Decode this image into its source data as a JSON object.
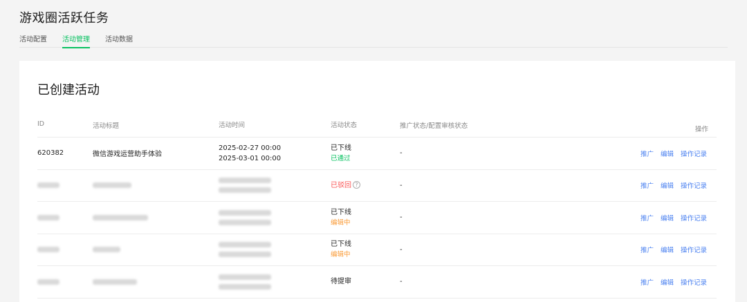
{
  "header": {
    "title": "游戏圈活跃任务"
  },
  "tabs": [
    {
      "label": "活动配置"
    },
    {
      "label": "活动管理"
    },
    {
      "label": "活动数据"
    }
  ],
  "card": {
    "title": "已创建活动"
  },
  "table": {
    "columns": {
      "id": "ID",
      "title": "活动标题",
      "time": "活动时间",
      "status": "活动状态",
      "promo": "推广状态/配置审核状态",
      "ops": "操作"
    },
    "rows": [
      {
        "id": "620382",
        "title": "微信游戏运营助手体验",
        "time_start": "2025-02-27 00:00",
        "time_end": "2025-03-01 00:00",
        "status": "已下线",
        "sub_status": "已通过",
        "promo": "-",
        "ops": [
          "推广",
          "编辑",
          "操作记录"
        ]
      },
      {
        "status": "已驳回",
        "promo": "-",
        "ops": [
          "推广",
          "编辑",
          "操作记录"
        ]
      },
      {
        "status": "已下线",
        "sub_status": "编辑中",
        "promo": "-",
        "ops": [
          "推广",
          "编辑",
          "操作记录"
        ]
      },
      {
        "status": "已下线",
        "sub_status": "编辑中",
        "promo": "-",
        "ops": [
          "推广",
          "编辑",
          "操作记录"
        ]
      },
      {
        "status": "待提审",
        "promo": "-",
        "ops": [
          "推广",
          "编辑",
          "操作记录"
        ]
      }
    ]
  },
  "colors": {
    "accent": "#07c160",
    "link": "#4a80f0",
    "warning": "#fa9d3b",
    "danger": "#fa5151"
  },
  "icons": {
    "help": "?"
  }
}
